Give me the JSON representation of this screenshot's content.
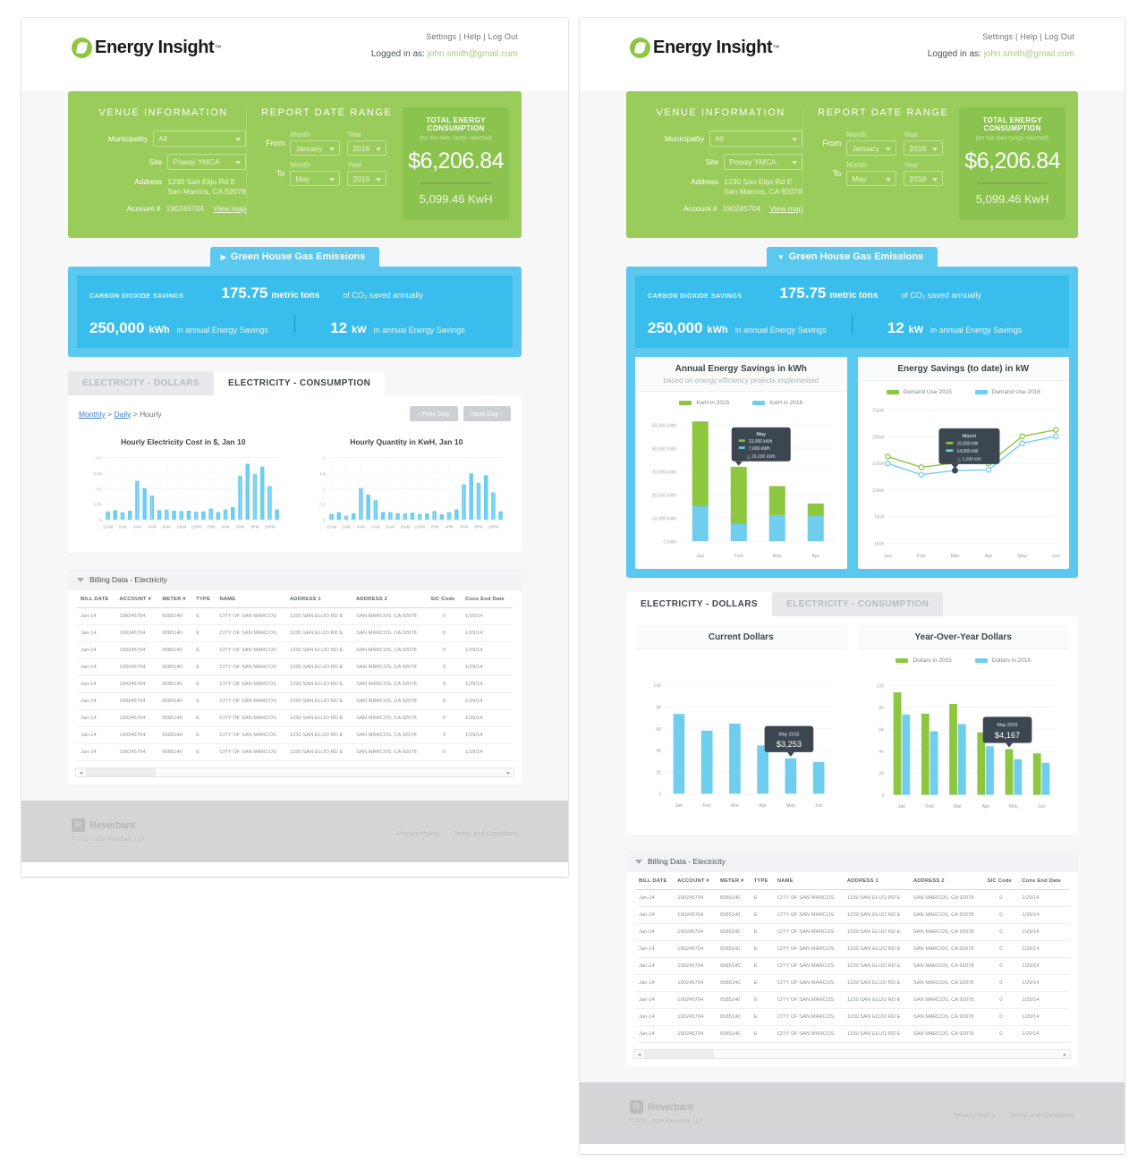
{
  "brand": {
    "name": "Energy Insight",
    "tm": "™",
    "footer_name": "Reverbant",
    "footer_tm": "™",
    "footer_copy": "© 2012 - 2016 Reverbant, LLP",
    "footer_mark_letter": "R"
  },
  "topnav": {
    "settings": "Settings",
    "help": "Help",
    "logout": "Log Out",
    "sep": "|",
    "logged_label": "Logged in as:",
    "email": "john.smith@gmail.com"
  },
  "venue": {
    "title": "VENUE  INFORMATION",
    "municipality_label": "Municipality",
    "municipality_value": "All",
    "site_label": "Site",
    "site_value": "Poway YMCA",
    "address_label": "Address",
    "address_line1": "1230 San Elijo Rd E",
    "address_line2": "San Marcos, CA  92078",
    "account_label": "Account #",
    "account_value": "190245704",
    "view_map": "View map"
  },
  "date_range": {
    "title": "REPORT DATE RANGE",
    "month_caption": "Month",
    "year_caption": "Year",
    "from_label": "From",
    "from_month": "January",
    "from_year": "2016",
    "to_label": "To",
    "to_month": "May",
    "to_year": "2016"
  },
  "total": {
    "title": "TOTAL ENERGY CONSUMPTION",
    "subtitle": "(for the date range selected)",
    "amount": "$6,206.84",
    "kwh": "5,099.46 KwH"
  },
  "ghg": {
    "tab_label": "Green House Gas Emissions",
    "tri_collapsed": "▶",
    "tri_expanded": "▼",
    "co2_label": "CARBON DIOXIDE SAVINGS",
    "metric_value": "175.75",
    "metric_unit": "metric tons",
    "metric_note": "of CO₂ saved annually",
    "kwh_value": "250,000",
    "kwh_unit": "kWh",
    "kwh_note": "in annual Energy Savings",
    "kw_value": "12",
    "kw_unit": "kW",
    "kw_note": "in annual Energy Savings"
  },
  "tabs": {
    "dollars": "ELECTRICITY - DOLLARS",
    "consumption": "ELECTRICITY - CONSUMPTION"
  },
  "breadcrumb": {
    "monthly": "Monthly",
    "sep": ">",
    "daily": "Daily",
    "hourly": "Hourly",
    "prev": "‹ Prev Day",
    "next": "Next Day ›"
  },
  "billing": {
    "section_title": "Billing Data - Electricity",
    "columns": [
      "BILL DATE",
      "ACCOUNT #",
      "METER #",
      "TYPE",
      "NAME",
      "ADDRESS 1",
      "ADDRESS 2",
      "SIC Code",
      "Cons End Date"
    ],
    "rows": [
      [
        "Jan-14",
        "190245704",
        "6585140",
        "E",
        "CITY OF SAN MARCOS",
        "1230 SAN ELIJO RD E",
        "SAN MARCOS, CA  92078",
        "0",
        "1/29/14"
      ],
      [
        "Jan-14",
        "190245704",
        "6585140",
        "E",
        "CITY OF SAN MARCOS",
        "1230 SAN ELIJO RD E",
        "SAN MARCOS, CA  92078",
        "0",
        "1/29/14"
      ],
      [
        "Jan-14",
        "190245704",
        "6585140",
        "E",
        "CITY OF SAN MARCOS",
        "1230 SAN ELIJO RD E",
        "SAN MARCOS, CA  92078",
        "0",
        "1/29/14"
      ],
      [
        "Jan-14",
        "190245704",
        "6585140",
        "E",
        "CITY OF SAN MARCOS",
        "1230 SAN ELIJO RD E",
        "SAN MARCOS, CA  92078",
        "0",
        "1/29/14"
      ],
      [
        "Jan-14",
        "190245704",
        "6585140",
        "E",
        "CITY OF SAN MARCOS",
        "1230 SAN ELIJO RD E",
        "SAN MARCOS, CA  92078",
        "0",
        "1/29/14"
      ],
      [
        "Jan-14",
        "190245704",
        "6585140",
        "E",
        "CITY OF SAN MARCOS",
        "1230 SAN ELIJO RD E",
        "SAN MARCOS, CA  92078",
        "0",
        "1/29/14"
      ],
      [
        "Jan-14",
        "190245704",
        "6585140",
        "E",
        "CITY OF SAN MARCOS",
        "1230 SAN ELIJO RD E",
        "SAN MARCOS, CA  92078",
        "0",
        "1/29/14"
      ],
      [
        "Jan-14",
        "190245704",
        "6585140",
        "E",
        "CITY OF SAN MARCOS",
        "1230 SAN ELIJO RD E",
        "SAN MARCOS, CA  92078",
        "0",
        "1/29/14"
      ],
      [
        "Jan-14",
        "190245704",
        "6585140",
        "E",
        "CITY OF SAN MARCOS",
        "1230 SAN ELIJO RD E",
        "SAN MARCOS, CA  92078",
        "0",
        "1/29/14"
      ]
    ]
  },
  "footer": {
    "privacy": "Privacy Policy",
    "terms": "Terms and Conditions"
  },
  "colors": {
    "green": "#99cc5a",
    "green_dark": "#8bc34f",
    "blue": "#5bc8f0",
    "blue_dark": "#38bdec",
    "bar_blue": "#6fcdee",
    "bar_green": "#8dc63f",
    "tooltip": "#3b4650",
    "footer_bg": "#d3d5d6"
  },
  "chart_data": [
    {
      "id": "hourly_cost",
      "type": "bar",
      "title": "Hourly Electricity Cost in $, Jan 10",
      "xlabel": "",
      "ylabel": "",
      "ylim": [
        0,
        0.2
      ],
      "yticks": [
        0,
        0.05,
        0.1,
        0.15,
        0.2
      ],
      "ytick_labels": [
        "0",
        "0.05",
        "0.1",
        "0.15",
        "0.2"
      ],
      "categories": [
        "12AM",
        "1AM",
        "2AM",
        "3AM",
        "4AM",
        "5AM",
        "6AM",
        "7AM",
        "8AM",
        "9AM",
        "10AM",
        "11AM",
        "12PM",
        "1PM",
        "2PM",
        "3PM",
        "4PM",
        "5PM",
        "6PM",
        "7PM",
        "8PM",
        "9PM",
        "10PM",
        "11PM"
      ],
      "tick_labels": [
        "12AM",
        "2AM",
        "4AM",
        "6AM",
        "8AM",
        "10AM",
        "12PM",
        "2PM",
        "4PM",
        "6PM",
        "8PM",
        "10PM"
      ],
      "values": [
        0.027,
        0.031,
        0.024,
        0.029,
        0.125,
        0.101,
        0.078,
        0.031,
        0.033,
        0.029,
        0.028,
        0.029,
        0.026,
        0.027,
        0.036,
        0.025,
        0.033,
        0.041,
        0.142,
        0.18,
        0.147,
        0.171,
        0.108,
        0.033
      ],
      "color": "#6fcdee",
      "grid": true,
      "legend": "none"
    },
    {
      "id": "hourly_quantity",
      "type": "bar",
      "title": "Hourly Quantity in KwH, Jan 10",
      "xlabel": "",
      "ylabel": "",
      "ylim": [
        0,
        2
      ],
      "yticks": [
        0,
        0.5,
        1,
        1.5,
        2
      ],
      "ytick_labels": [
        "0",
        "0.5",
        "1",
        "1.5",
        "2"
      ],
      "categories": [
        "12AM",
        "1AM",
        "2AM",
        "3AM",
        "4AM",
        "5AM",
        "6AM",
        "7AM",
        "8AM",
        "9AM",
        "10AM",
        "11AM",
        "12PM",
        "1PM",
        "2PM",
        "3PM",
        "4PM",
        "5PM",
        "6PM",
        "7PM",
        "8PM",
        "9PM",
        "10PM",
        "11PM"
      ],
      "tick_labels": [
        "12AM",
        "2AM",
        "4AM",
        "6AM",
        "8AM",
        "10AM",
        "12PM",
        "2PM",
        "4PM",
        "6PM",
        "8PM",
        "10PM"
      ],
      "values": [
        0.19,
        0.24,
        0.13,
        0.21,
        1.02,
        0.81,
        0.63,
        0.25,
        0.25,
        0.21,
        0.21,
        0.23,
        0.19,
        0.2,
        0.28,
        0.18,
        0.25,
        0.33,
        1.14,
        1.49,
        1.19,
        1.43,
        0.88,
        0.27,
        0.17
      ],
      "color": "#6fcdee",
      "grid": true,
      "legend": "none"
    },
    {
      "id": "annual_energy_savings",
      "type": "bar",
      "stacked": true,
      "title": "Annual Energy Savings in kWh",
      "subtitle": "based on energy efficiency projects implemented",
      "ylim": [
        0,
        55000
      ],
      "yticks": [
        0,
        10000,
        20000,
        30000,
        40000,
        50000
      ],
      "ytick_labels": [
        "0 kWh",
        "10,000 kWh",
        "20,000 kWh",
        "30,000 kWh",
        "40,000 kWh",
        "50,000 kWh"
      ],
      "categories": [
        "Jan",
        "Feb",
        "Mar",
        "Apr"
      ],
      "series": [
        {
          "name": "KwH in 2016",
          "color": "#6fcdee",
          "values": [
            15000,
            7500,
            11200,
            10800
          ]
        },
        {
          "name": "KwH in 2015",
          "color": "#8dc63f",
          "values": [
            36500,
            24500,
            12500,
            5400
          ]
        }
      ],
      "legend": [
        "KwH in 2015",
        "KwH in 2016"
      ],
      "legend_position": "top",
      "tooltip": {
        "title": "May",
        "rows": [
          {
            "swatch": "#8dc63f",
            "text": "33,000 kWh"
          },
          {
            "swatch": "#6fcdee",
            "text": "7,000 kWh"
          }
        ],
        "delta": "△ 26,000 kWh",
        "anchor_category": "Feb"
      },
      "grid": true
    },
    {
      "id": "energy_savings_to_date",
      "type": "line",
      "title": "Energy Savings (to date) in kW",
      "ylim": [
        0,
        26
      ],
      "yticks": [
        0,
        5,
        10,
        15,
        20,
        25
      ],
      "ytick_labels": [
        "0kW",
        "5kW",
        "10kW",
        "15kW",
        "20kW",
        "25kW"
      ],
      "categories": [
        "Jan",
        "Feb",
        "Mar",
        "Apr",
        "May",
        "Jun"
      ],
      "series": [
        {
          "name": "Demand Use 2015",
          "color": "#8dc63f",
          "values": [
            16.2,
            14.2,
            15.0,
            14.9,
            20.0,
            21.2
          ]
        },
        {
          "name": "Demand Use 2016",
          "color": "#6fcdee",
          "values": [
            14.9,
            12.8,
            13.6,
            13.7,
            18.7,
            20.0
          ]
        }
      ],
      "legend": [
        "Demand Use 2015",
        "Demand Use 2016"
      ],
      "legend_position": "top",
      "tooltip": {
        "title": "March",
        "rows": [
          {
            "swatch": "#8dc63f",
            "text": "15,000 kW"
          },
          {
            "swatch": "#6fcdee",
            "text": "14,000 kW"
          }
        ],
        "delta": "△ 1,000 kW",
        "anchor_category": "Mar"
      },
      "grid": true
    },
    {
      "id": "current_dollars",
      "type": "bar",
      "title": "Current Dollars",
      "ylim": [
        0,
        11000
      ],
      "yticks": [
        0,
        2000,
        4000,
        6000,
        8000,
        10000
      ],
      "ytick_labels": [
        "0",
        "2K",
        "4K",
        "6K",
        "8K",
        "10K"
      ],
      "categories": [
        "Jan",
        "Feb",
        "Mar",
        "Apr",
        "May",
        "Jun"
      ],
      "values": [
        7330,
        5800,
        6450,
        4430,
        3253,
        2920
      ],
      "color": "#6fcdee",
      "tooltip": {
        "title": "May 2016",
        "value": "$3,253",
        "anchor_category": "May"
      },
      "grid": true,
      "legend": "none"
    },
    {
      "id": "year_over_year_dollars",
      "type": "bar",
      "title": "Year-Over-Year Dollars",
      "ylim": [
        0,
        11000
      ],
      "yticks": [
        0,
        2000,
        4000,
        6000,
        8000,
        10000
      ],
      "ytick_labels": [
        "0",
        "2K",
        "4K",
        "6K",
        "8K",
        "10K"
      ],
      "categories": [
        "Jan",
        "Feb",
        "Mar",
        "Apr",
        "May",
        "Jun"
      ],
      "series": [
        {
          "name": "Dollars in 2015",
          "color": "#8dc63f",
          "values": [
            9350,
            7400,
            8300,
            5700,
            4167,
            3780
          ]
        },
        {
          "name": "Dollars in 2016",
          "color": "#6fcdee",
          "values": [
            7330,
            5800,
            6450,
            4430,
            3253,
            2920
          ]
        }
      ],
      "legend": [
        "Dollars in 2015",
        "Dollars in 2016"
      ],
      "legend_position": "top",
      "tooltip": {
        "title": "May 2015",
        "value": "$4,167",
        "anchor_category": "May"
      },
      "grid": true
    }
  ]
}
